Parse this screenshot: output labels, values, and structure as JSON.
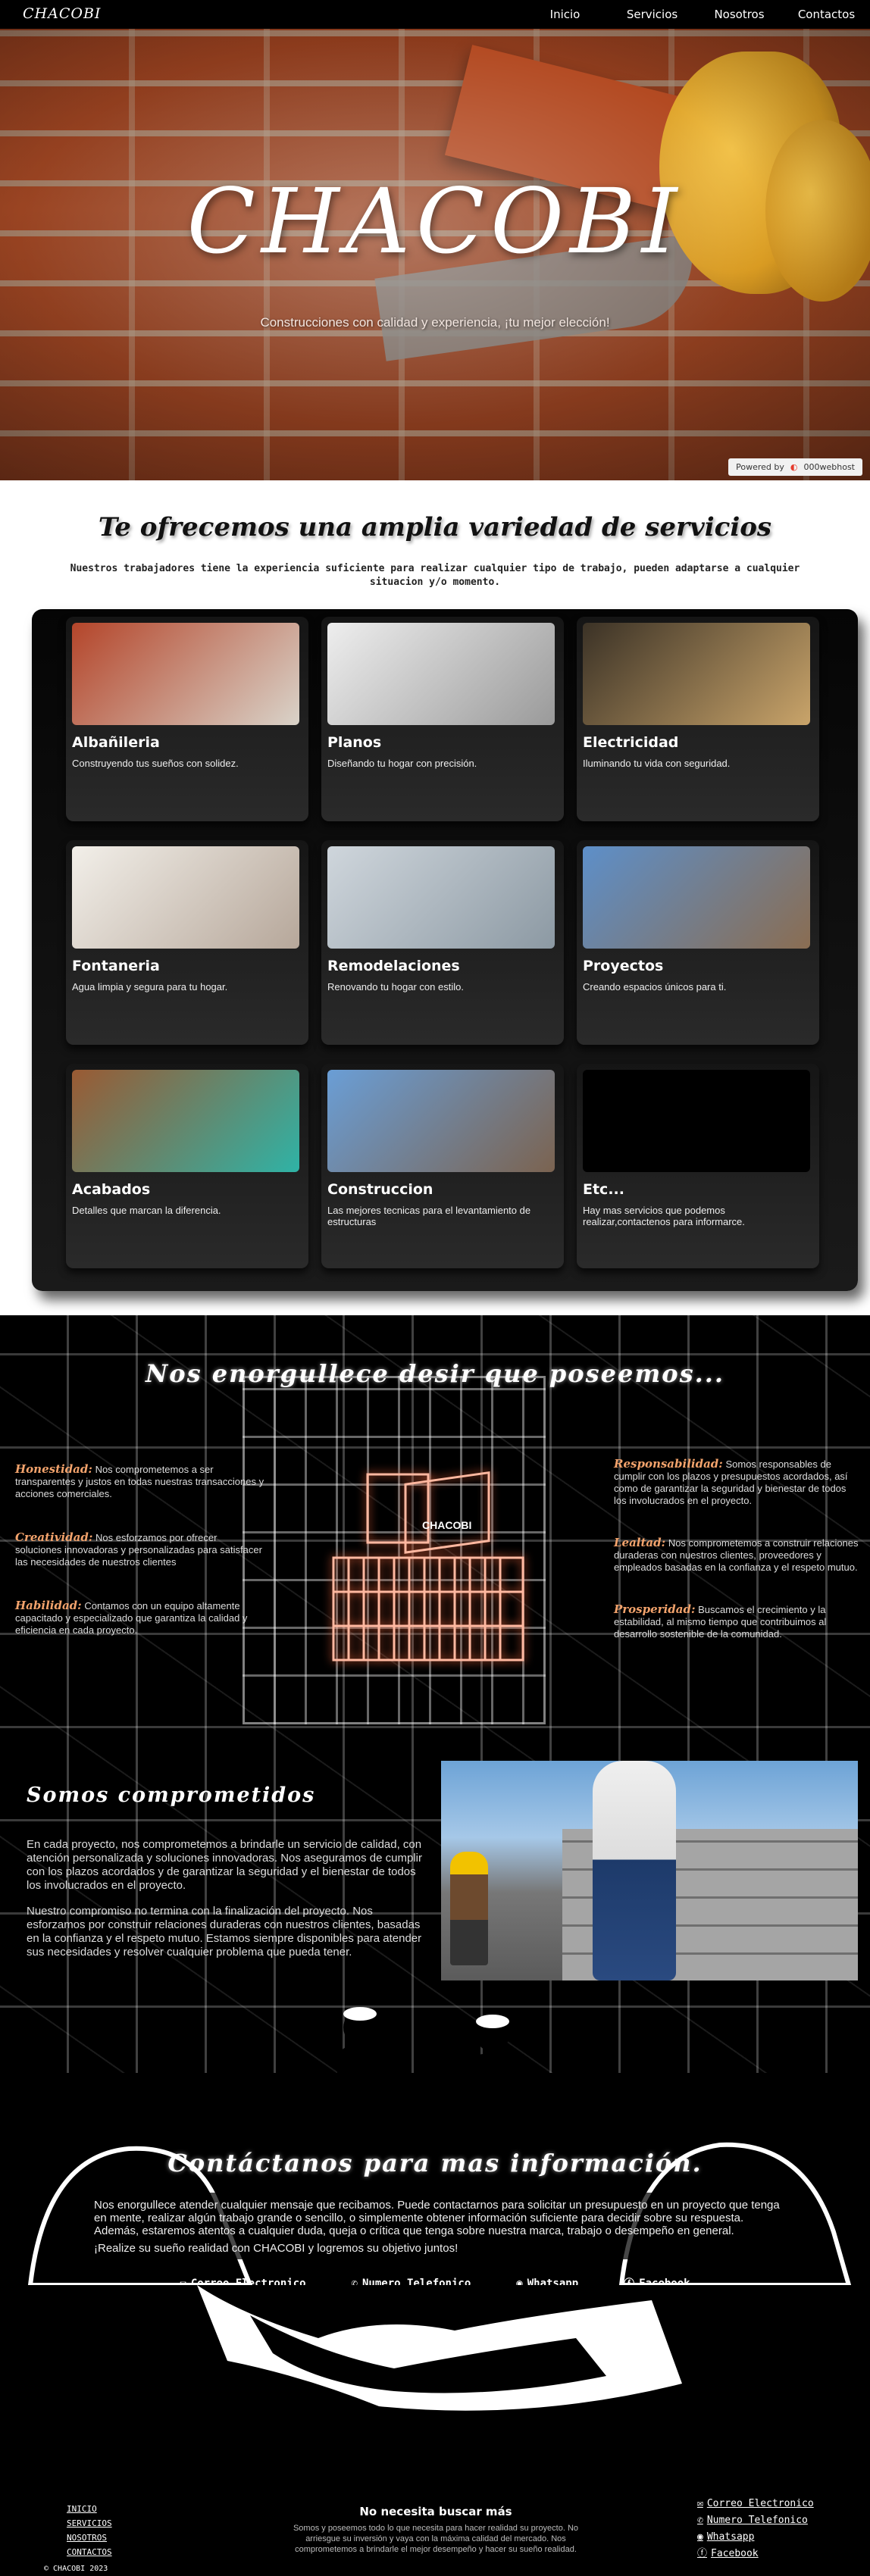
{
  "nav": {
    "brand": "CHACOBI",
    "links": [
      "Inicio",
      "Servicios",
      "Nosotros",
      "Contactos"
    ]
  },
  "hero": {
    "title": "CHACOBI",
    "tagline": "Construcciones con calidad y experiencia, ¡tu mejor elección!",
    "powered_label": "Powered by",
    "powered_brand": "000webhost"
  },
  "services": {
    "heading": "Te ofrecemos una amplia variedad de servicios",
    "description": "Nuestros trabajadores tiene la experiencia suficiente para realizar cualquier tipo de trabajo, pueden adaptarse a cualquier situacion y/o momento.",
    "cards": [
      {
        "title": "Albañileria",
        "text": "Construyendo tus sueños con solidez.",
        "colors": [
          "#b4452a",
          "#d9d3c9"
        ]
      },
      {
        "title": "Planos",
        "text": "Diseñando tu hogar con precisión.",
        "colors": [
          "#eeeeee",
          "#9a9a9a"
        ]
      },
      {
        "title": "Electricidad",
        "text": "Iluminando tu vida con seguridad.",
        "colors": [
          "#3b3226",
          "#c9a46a"
        ]
      },
      {
        "title": "Fontaneria",
        "text": "Agua limpia y segura para tu hogar.",
        "colors": [
          "#f2efe9",
          "#b6a79a"
        ]
      },
      {
        "title": "Remodelaciones",
        "text": "Renovando tu hogar con estilo.",
        "colors": [
          "#cfd6dc",
          "#8c99a3"
        ]
      },
      {
        "title": "Proyectos",
        "text": "Creando espacios únicos para ti.",
        "colors": [
          "#5d8fc9",
          "#8a6d52"
        ]
      },
      {
        "title": "Acabados",
        "text": "Detalles que marcan la diferencia.",
        "colors": [
          "#9a5a33",
          "#2fb3a6"
        ]
      },
      {
        "title": "Construccion",
        "text": "Las mejores tecnicas para el levantamiento de estructuras",
        "colors": [
          "#6a9ed6",
          "#7b6350"
        ]
      },
      {
        "title": "Etc...",
        "text": "Hay mas servicios que podemos realizar,contactenos para informarce.",
        "colors": [
          "#000000",
          "#000000"
        ]
      }
    ]
  },
  "values": {
    "heading": "Nos enorgullece desir que poseemos...",
    "logo_text": "CHACOBI",
    "left": [
      {
        "name": "Honestidad:",
        "text": "Nos comprometemos a ser transparentes y justos en todas nuestras transacciones y acciones comerciales."
      },
      {
        "name": "Creatividad:",
        "text": "Nos esforzamos por ofrecer soluciones innovadoras y personalizadas para satisfacer las necesidades de nuestros clientes"
      },
      {
        "name": "Habilidad:",
        "text": "Contamos con un equipo altamente capacitado y especializado que garantiza la calidad y eficiencia en cada proyecto."
      }
    ],
    "right": [
      {
        "name": "Responsabilidad:",
        "text": "Somos responsables de cumplir con los plazos y presupuestos acordados, así como de garantizar la seguridad y bienestar de todos los involucrados en el proyecto."
      },
      {
        "name": "Lealtad:",
        "text": "Nos comprometemos a construir relaciones duraderas con nuestros clientes, proveedores y empleados basadas en la confianza y el respeto mutuo."
      },
      {
        "name": "Prosperidad:",
        "text": "Buscamos el crecimiento y la estabilidad, al mismo tiempo que contribuimos al desarrollo sostenible de la comunidad."
      }
    ]
  },
  "commitment": {
    "heading": "Somos comprometidos",
    "p1": "En cada proyecto, nos comprometemos a brindarle un servicio de calidad, con atención personalizada y soluciones innovadoras. Nos aseguramos de cumplir con los plazos acordados y de garantizar la seguridad y el bienestar de todos los involucrados en el proyecto.",
    "p2": "Nuestro compromiso no termina con la finalización del proyecto. Nos esforzamos por construir relaciones duraderas con nuestros clientes, basadas en la confianza y el respeto mutuo. Estamos siempre disponibles para atender sus necesidades y resolver cualquier problema que pueda tener."
  },
  "contact": {
    "heading": "Contáctanos para mas información.",
    "p1": "Nos enorgullece atender cualquier mensaje que recibamos. Puede contactarnos para solicitar un presupuesto en un proyecto que tenga en mente, realizar algún trabajo grande o sencillo, o simplemente obtener información suficiente para decidir sobre su respuesta. Además, estaremos atentos a cualquier duda, queja o crítica que tenga sobre nuestra marca, trabajo o desempeño en general.",
    "p2": "¡Realize su sueño realidad con CHACOBI y logremos su objetivo juntos!",
    "links": [
      {
        "label": "Correo Electronico",
        "icon": "mail-icon"
      },
      {
        "label": "Numero Telefonico",
        "icon": "phone-icon"
      },
      {
        "label": "Whatsapp",
        "icon": "whatsapp-icon"
      },
      {
        "label": "Facebook",
        "icon": "facebook-icon"
      }
    ]
  },
  "footer": {
    "links": [
      "INICIO",
      "SERVICIOS",
      "NOSOTROS",
      "CONTACTOS"
    ],
    "heading": "No necesita buscar más",
    "text": "Somos y poseemos todo lo que necesita para hacer realidad su proyecto. No arriesgue su inversión y vaya con la máxima calidad del mercado. Nos comprometemos a brindarle el mejor desempeño y hacer su sueño realidad.",
    "contact_links": [
      "Correo Electronico",
      "Numero Telefonico",
      "Whatsapp",
      "Facebook"
    ],
    "copyright": "© CHACOBI 2023"
  }
}
